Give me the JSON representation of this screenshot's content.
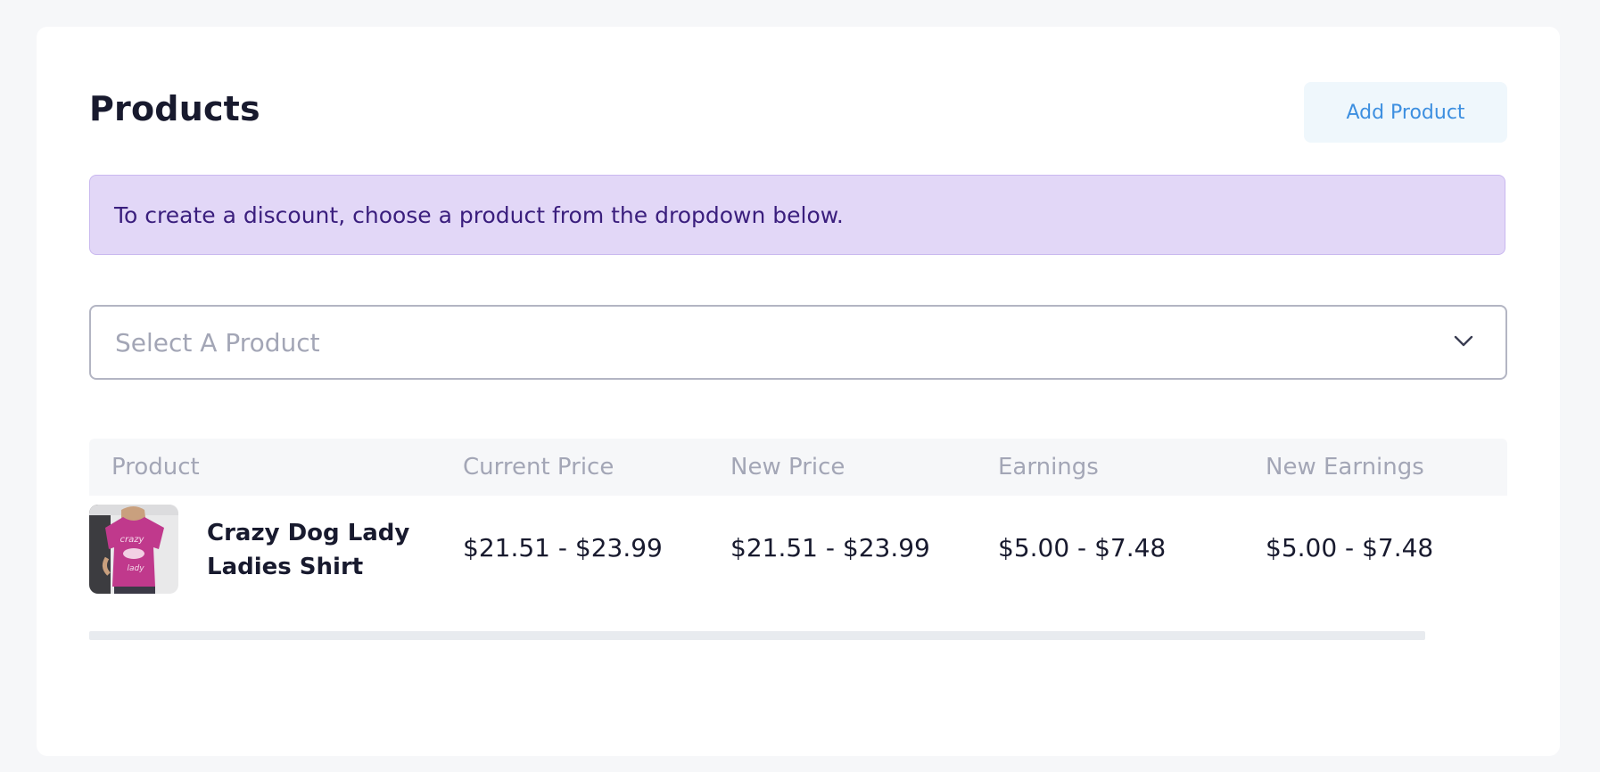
{
  "header": {
    "title": "Products",
    "add_button_label": "Add Product"
  },
  "alert": {
    "text": "To create a discount, choose a product from the dropdown below."
  },
  "product_select": {
    "placeholder": "Select A Product",
    "icon": "chevron-down-icon"
  },
  "table": {
    "columns": [
      "Product",
      "Current Price",
      "New Price",
      "Earnings",
      "New Earnings"
    ],
    "rows": [
      {
        "product": "Crazy Dog Lady Ladies Shirt",
        "current_price": "$21.51 - $23.99",
        "new_price": "$21.51 - $23.99",
        "earnings": "$5.00 - $7.48",
        "new_earnings": "$5.00 - $7.48"
      }
    ]
  },
  "colors": {
    "page_bg": "#f6f7f9",
    "card_bg": "#ffffff",
    "accent": "#3d8fe0",
    "alert_bg": "#e2d7f7",
    "alert_text": "#3a1e7d",
    "shirt": "#c0398c"
  }
}
